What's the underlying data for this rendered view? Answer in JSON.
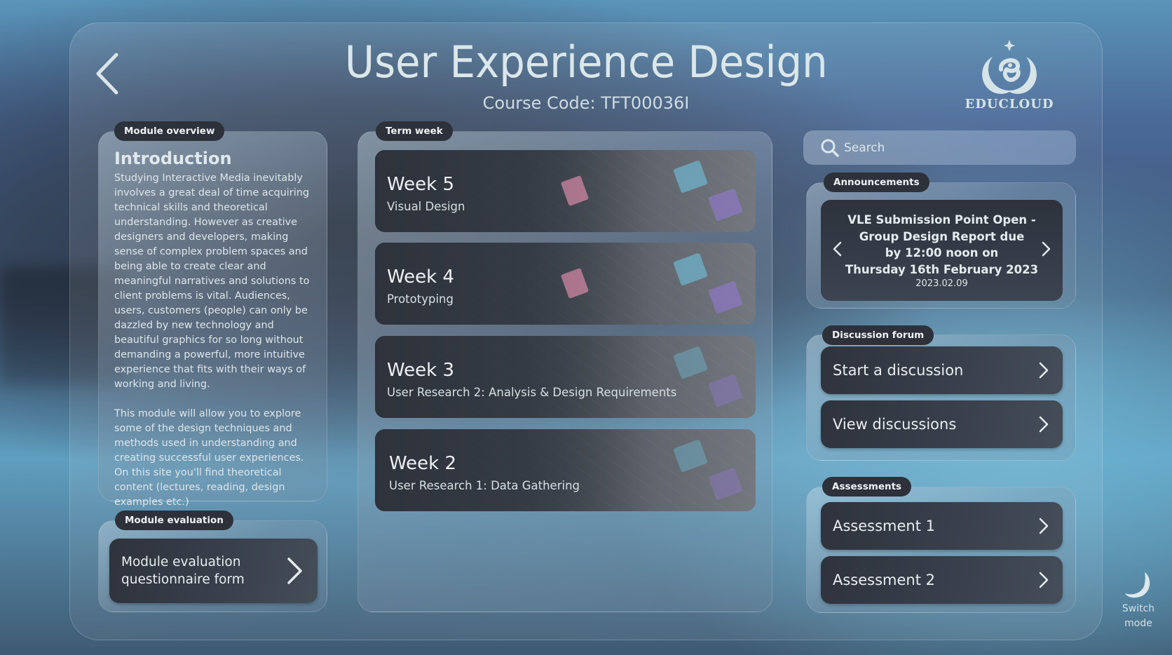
{
  "header": {
    "back_icon": "chevron-left-icon",
    "title": "User Experience Design",
    "course_code": "Course Code: TFT00036I",
    "logo_text": "EDUCLOUD"
  },
  "module_overview": {
    "pill_label": "Module overview",
    "heading": "Introduction",
    "paragraphs": [
      "Studying Interactive Media inevitably involves a great deal of time acquiring technical skills and theoretical understanding. However as creative designers and developers, making sense of complex problem spaces and being able to create clear and meaningful narratives and solutions to client problems is vital. Audiences, users, customers (people) can only be dazzled by new technology and beautiful graphics for so long without demanding a powerful, more intuitive experience that fits with their ways of working and living.",
      "This module will allow you to explore some of the design techniques and methods used in understanding and creating successful user experiences. On this site you'll find theoretical content (lectures, reading, design examples etc.)"
    ]
  },
  "module_evaluation": {
    "pill_label": "Module evaluation",
    "button_line1": "Module evaluation",
    "button_line2": "questionnaire form"
  },
  "term_week": {
    "pill_label": "Term week",
    "weeks": [
      {
        "title": "Week 5",
        "subtitle": "Visual Design"
      },
      {
        "title": "Week 4",
        "subtitle": "Prototyping"
      },
      {
        "title": "Week 3",
        "subtitle": "User Research 2: Analysis & Design Requirements"
      },
      {
        "title": "Week 2",
        "subtitle": "User Research 1: Data Gathering"
      }
    ]
  },
  "search": {
    "placeholder": "Search",
    "value": ""
  },
  "announcements": {
    "pill_label": "Announcements",
    "items": [
      {
        "lines": [
          "VLE Submission Point Open -",
          "Group Design Report due",
          "by 12:00 noon on",
          "Thursday 16th February 2023"
        ],
        "date": "2023.02.09"
      }
    ]
  },
  "discussion_forum": {
    "pill_label": "Discussion forum",
    "buttons": [
      {
        "label": "Start a discussion"
      },
      {
        "label": "View discussions"
      }
    ]
  },
  "assessments": {
    "pill_label": "Assessments",
    "buttons": [
      {
        "label": "Assessment 1"
      },
      {
        "label": "Assessment 2"
      }
    ]
  },
  "switch_mode": {
    "icon": "moon-icon",
    "line1": "Switch",
    "line2": "mode"
  },
  "colors": {
    "pill_bg": "#2c313a",
    "button_bg": "#2e333d",
    "text_light": "#e4ecef"
  }
}
